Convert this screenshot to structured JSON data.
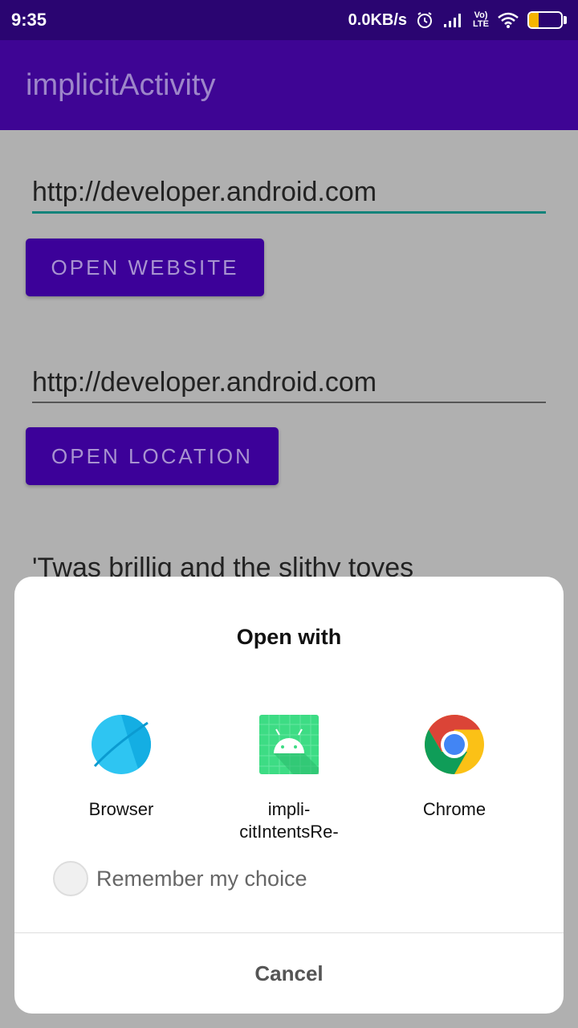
{
  "status_bar": {
    "time": "9:35",
    "net_speed": "0.0KB/s",
    "volte": "Vo)",
    "lte": "LTE",
    "battery_level": "31",
    "battery_fraction": 0.31,
    "icons": [
      "alarm-icon",
      "signal-icon",
      "volte-icon",
      "wifi-icon",
      "battery-icon"
    ]
  },
  "app_bar": {
    "title": "implicitActivity"
  },
  "main": {
    "website_input": {
      "value": "http://developer.android.com"
    },
    "open_website_label": "OPEN WEBSITE",
    "location_input": {
      "value": "http://developer.android.com"
    },
    "open_location_label": "OPEN LOCATION",
    "share_text": "'Twas brillig and the slithy toves"
  },
  "dialog": {
    "title": "Open with",
    "apps": [
      {
        "label": "Browser",
        "icon": "browser-icon"
      },
      {
        "label": "impli-\ncitIntentsRe-",
        "icon": "android-icon"
      },
      {
        "label": "Chrome",
        "icon": "chrome-icon"
      }
    ],
    "remember_label": "Remember my choice",
    "cancel_label": "Cancel"
  },
  "colors": {
    "status_bar": "#2a0571",
    "app_bar": "#3e0594",
    "button": "#3c0199",
    "accent": "#11837a",
    "scrim": "#b0b0b0"
  }
}
